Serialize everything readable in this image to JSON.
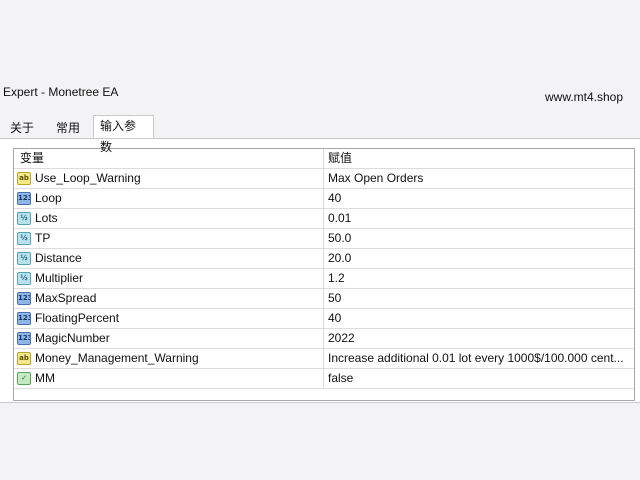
{
  "window": {
    "title": "Expert - Monetree EA",
    "watermark": "www.mt4.shop"
  },
  "tabs": [
    {
      "label": "关于",
      "active": false
    },
    {
      "label": "常用",
      "active": false
    },
    {
      "label": "输入参数",
      "active": true
    }
  ],
  "table": {
    "headers": {
      "variable": "变量",
      "value": "赋值"
    },
    "rows": [
      {
        "icon": "string-icon",
        "badge": "ab",
        "name": "Use_Loop_Warning",
        "value": "Max Open Orders"
      },
      {
        "icon": "integer-icon",
        "badge": "123",
        "name": "Loop",
        "value": "40"
      },
      {
        "icon": "double-icon",
        "badge": "½",
        "name": "Lots",
        "value": "0.01"
      },
      {
        "icon": "double-icon",
        "badge": "½",
        "name": "TP",
        "value": "50.0"
      },
      {
        "icon": "double-icon",
        "badge": "½",
        "name": "Distance",
        "value": "20.0"
      },
      {
        "icon": "double-icon",
        "badge": "½",
        "name": "Multiplier",
        "value": "1.2"
      },
      {
        "icon": "integer-icon",
        "badge": "123",
        "name": "MaxSpread",
        "value": "50"
      },
      {
        "icon": "integer-icon",
        "badge": "123",
        "name": "FloatingPercent",
        "value": "40"
      },
      {
        "icon": "integer-icon",
        "badge": "123",
        "name": "MagicNumber",
        "value": "2022"
      },
      {
        "icon": "string-icon",
        "badge": "ab",
        "name": "Money_Management_Warning",
        "value": "Increase additional 0.01 lot every 1000$/100.000 cent..."
      },
      {
        "icon": "boolean-icon",
        "badge": "✓",
        "name": "MM",
        "value": "false"
      }
    ]
  }
}
